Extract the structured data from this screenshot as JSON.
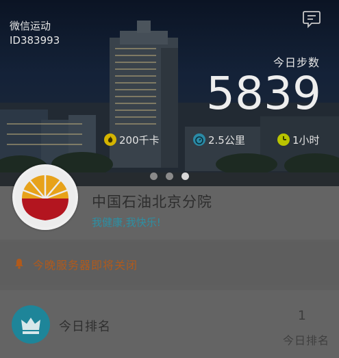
{
  "header": {
    "app_name": "微信运动",
    "user_id": "ID383993",
    "message_icon": "chat-bubble-icon"
  },
  "steps": {
    "label": "今日步数",
    "value": "5839"
  },
  "stats": [
    {
      "icon": "flame-icon",
      "label": "200千卡",
      "color": "#d4b400"
    },
    {
      "icon": "stopwatch-icon",
      "label": "2.5公里",
      "color": "#2a8aa6"
    },
    {
      "icon": "clock-icon",
      "label": "1小时",
      "color": "#b9c400"
    }
  ],
  "carousel": {
    "count": 3,
    "active_index": 2
  },
  "profile": {
    "org_name": "中国石油北京分院",
    "slogan": "我健康,我快乐!",
    "logo_icon": "petrochina-logo-icon"
  },
  "notice": {
    "icon": "bell-icon",
    "text": "今晚服务器即将关闭",
    "color": "#b05a1c"
  },
  "ranking": {
    "icon": "crown-icon",
    "title": "今日排名",
    "rank_value": "1",
    "rank_label": "今日排名"
  }
}
